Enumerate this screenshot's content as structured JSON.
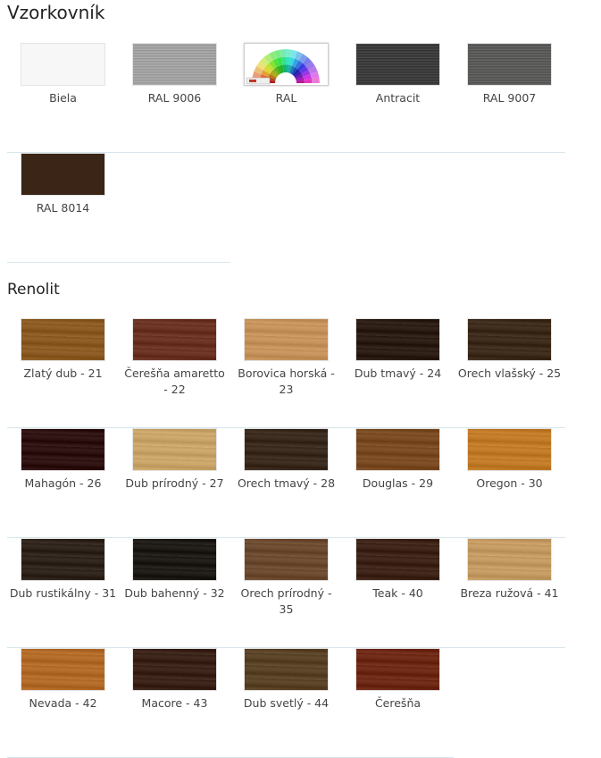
{
  "sections": [
    {
      "title": "Vzorkovník",
      "rows": [
        [
          {
            "label": "Biela",
            "color": "#f7f7f7",
            "texture": "plain"
          },
          {
            "label": "RAL 9006",
            "color": "#a3a3a3",
            "texture": "ribbed"
          },
          {
            "label": "RAL",
            "color": "#ffffff",
            "texture": "fan"
          },
          {
            "label": "Antracit",
            "color": "#3e3e3e",
            "texture": "ribbed"
          },
          {
            "label": "RAL 9007",
            "color": "#5c5c5a",
            "texture": "ribbed"
          }
        ],
        [
          {
            "label": "RAL 8014",
            "color": "#3a2516",
            "texture": "plain"
          }
        ]
      ]
    },
    {
      "title": "Renolit",
      "rows": [
        [
          {
            "label": "Zlatý dub - 21",
            "color": "#8a5a22",
            "texture": "wood"
          },
          {
            "label": "Čerešňa amaretto - 22",
            "color": "#6a3222",
            "texture": "wood"
          },
          {
            "label": "Borovica horská - 23",
            "color": "#c4925a",
            "texture": "wood"
          },
          {
            "label": "Dub tmavý - 24",
            "color": "#2c1d14",
            "texture": "wood"
          },
          {
            "label": "Orech vlašský - 25",
            "color": "#3c2a1a",
            "texture": "wood"
          }
        ],
        [
          {
            "label": "Mahagón - 26",
            "color": "#2e1212",
            "texture": "wood"
          },
          {
            "label": "Dub prírodný - 27",
            "color": "#c8a468",
            "texture": "wood"
          },
          {
            "label": "Orech tmavý - 28",
            "color": "#3a2a1e",
            "texture": "wood"
          },
          {
            "label": "Douglas - 29",
            "color": "#7a4a22",
            "texture": "wood"
          },
          {
            "label": "Oregon - 30",
            "color": "#c07a28",
            "texture": "wood"
          }
        ],
        [
          {
            "label": "Dub rustikálny - 31",
            "color": "#2e241c",
            "texture": "wood"
          },
          {
            "label": "Dub bahenný - 32",
            "color": "#1e1a16",
            "texture": "wood"
          },
          {
            "label": "Orech prírodný - 35",
            "color": "#6c4a30",
            "texture": "wood"
          },
          {
            "label": "Teak - 40",
            "color": "#3e2418",
            "texture": "wood"
          },
          {
            "label": "Breza ružová - 41",
            "color": "#c29a62",
            "texture": "wood"
          }
        ],
        [
          {
            "label": "Nevada - 42",
            "color": "#b26a28",
            "texture": "wood"
          },
          {
            "label": "Macore - 43",
            "color": "#3a2218",
            "texture": "wood"
          },
          {
            "label": "Dub svetlý - 44",
            "color": "#5a4226",
            "texture": "wood"
          },
          {
            "label": "Čerešňa",
            "color": "#6e2816",
            "texture": "wood"
          }
        ]
      ]
    }
  ]
}
